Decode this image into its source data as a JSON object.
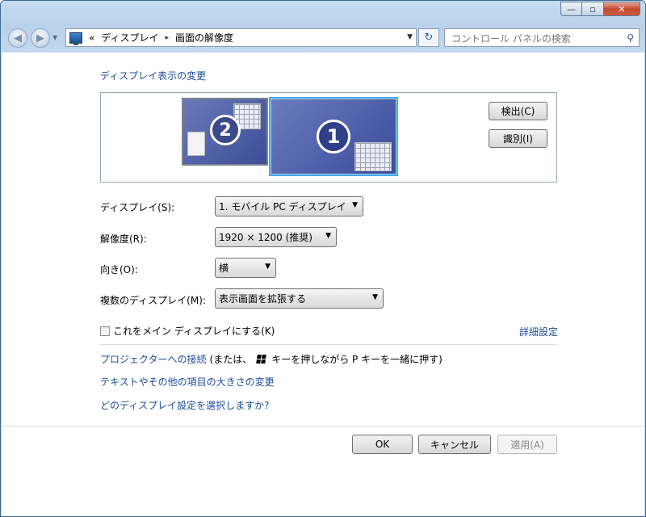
{
  "window": {
    "caption_buttons": {
      "minimize": "—",
      "maximize": "▫",
      "close": "✕"
    }
  },
  "nav": {
    "back_icon": "◀",
    "forward_icon": "▶",
    "recent_icon": "▼",
    "address": {
      "overflow": "«",
      "crumbs": [
        "ディスプレイ",
        "画面の解像度"
      ],
      "sep": "▸",
      "dropdown": "▼"
    },
    "refresh_icon": "↻",
    "search": {
      "placeholder": "コントロール パネルの検索",
      "icon": "⚲"
    }
  },
  "main": {
    "heading": "ディスプレイ表示の変更",
    "monitors": [
      {
        "number": "2"
      },
      {
        "number": "1"
      }
    ],
    "detect_button": "検出(C)",
    "identify_button": "識別(I)",
    "display_label": "ディスプレイ(S):",
    "display_value": "1. モバイル PC ディスプレイ",
    "resolution_label": "解像度(R):",
    "resolution_value": "1920 × 1200 (推奨)",
    "orientation_label": "向き(O):",
    "orientation_value": "横",
    "multi_label": "複数のディスプレイ(M):",
    "multi_value": "表示画面を拡張する",
    "dropdown_arrow": "▼",
    "main_display_checkbox": "これをメイン ディスプレイにする(K)",
    "main_display_checked": false,
    "advanced_link": "詳細設定",
    "projector_link": "プロジェクターへの接続",
    "projector_hint_pre": "(または、",
    "projector_hint_post": "キーを押しながら P キーを一緒に押す)",
    "text_size_link": "テキストやその他の項目の大きさの変更",
    "which_settings_link": "どのディスプレイ設定を選択しますか?"
  },
  "footer": {
    "ok": "OK",
    "cancel": "キャンセル",
    "apply": "適用(A)"
  }
}
